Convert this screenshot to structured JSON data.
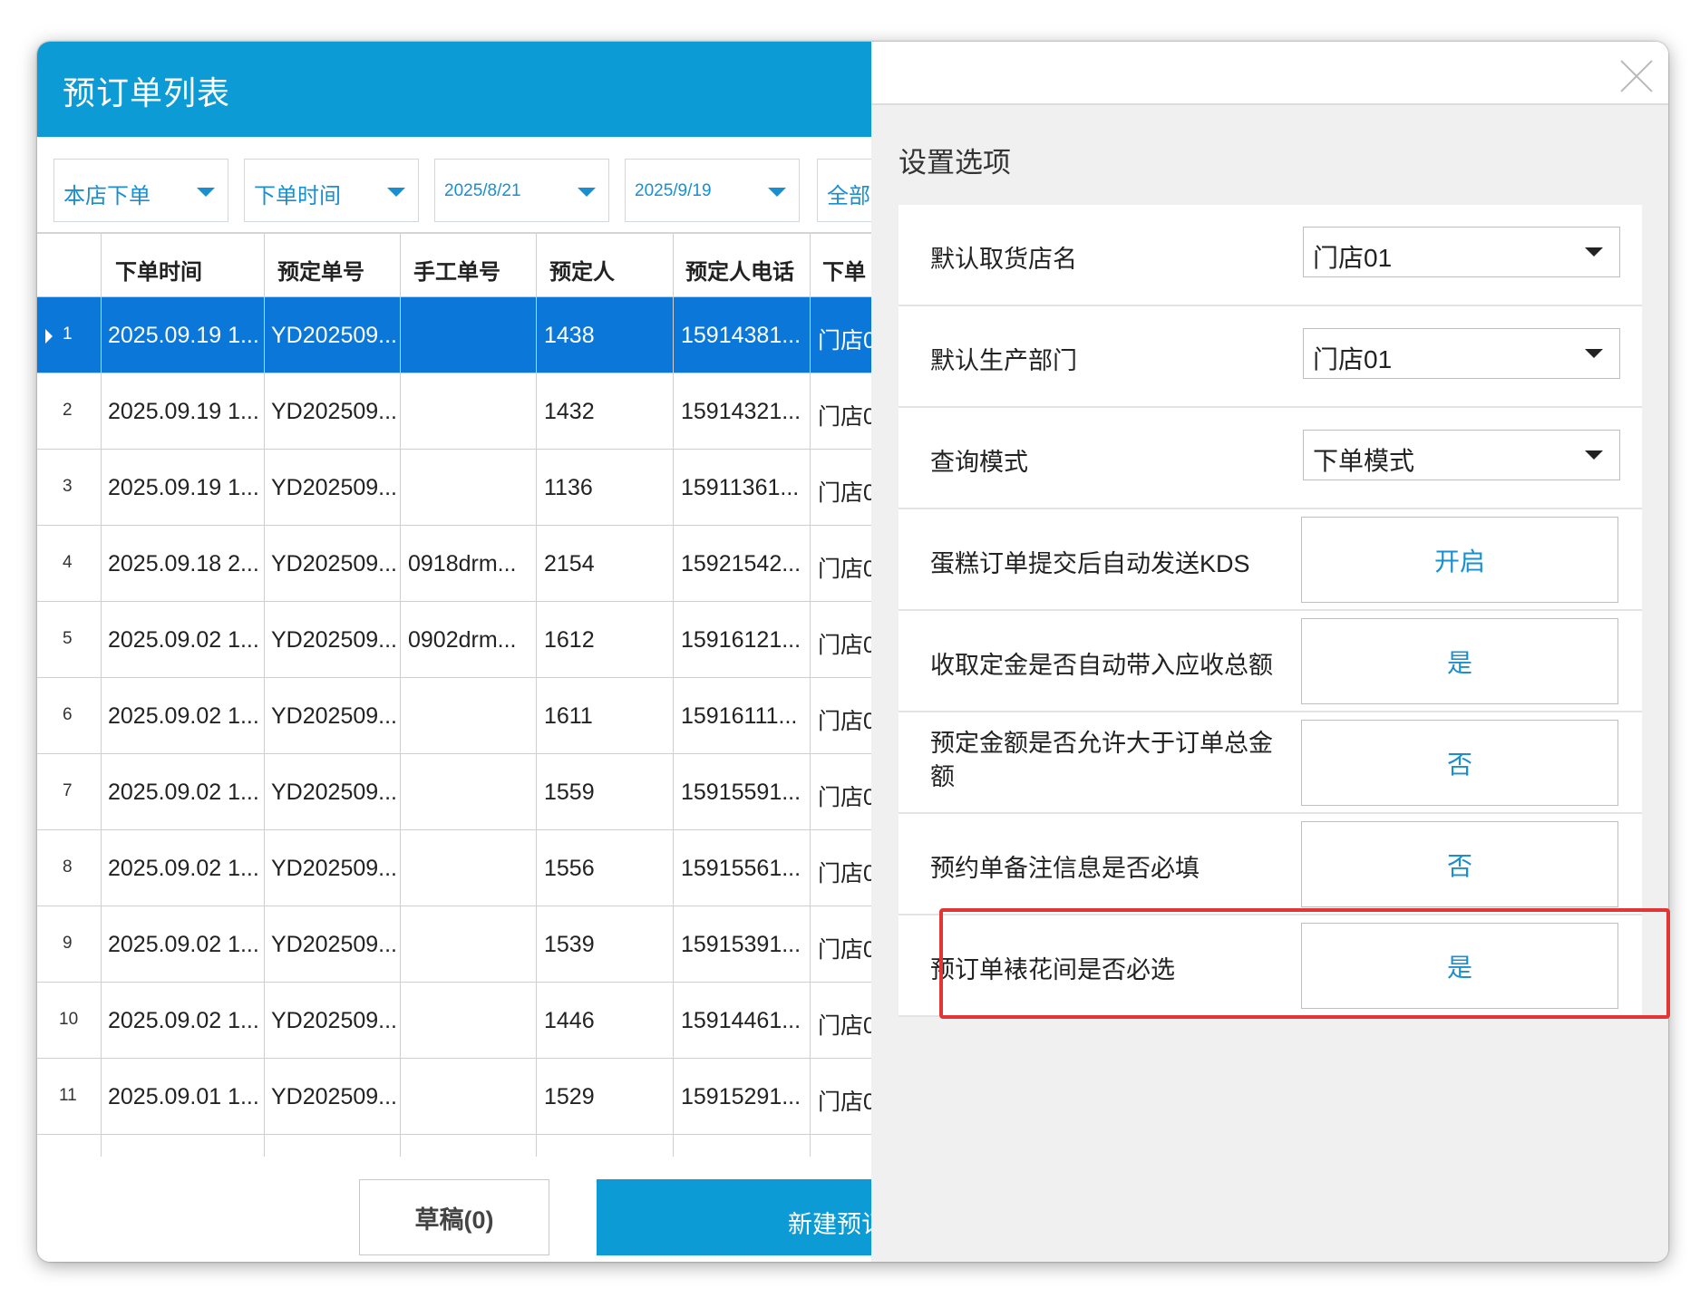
{
  "left_panel": {
    "title": "预订单列表",
    "filters": {
      "store": "本店下单",
      "time_type": "下单时间",
      "date_from": "2025/8/21",
      "date_to": "2025/9/19",
      "status": "全部"
    },
    "columns": [
      "下单时间",
      "预定单号",
      "手工单号",
      "预定人",
      "预定人电话",
      "下单"
    ],
    "rows": [
      {
        "no": "1",
        "time": "2025.09.19 1...",
        "order": "YD202509...",
        "manual": "",
        "person": "1438",
        "phone": "15914381...",
        "store": "门店0"
      },
      {
        "no": "2",
        "time": "2025.09.19 1...",
        "order": "YD202509...",
        "manual": "",
        "person": "1432",
        "phone": "15914321...",
        "store": "门店0"
      },
      {
        "no": "3",
        "time": "2025.09.19 1...",
        "order": "YD202509...",
        "manual": "",
        "person": "1136",
        "phone": "15911361...",
        "store": "门店0"
      },
      {
        "no": "4",
        "time": "2025.09.18 2...",
        "order": "YD202509...",
        "manual": "0918drm...",
        "person": "2154",
        "phone": "15921542...",
        "store": "门店0"
      },
      {
        "no": "5",
        "time": "2025.09.02 1...",
        "order": "YD202509...",
        "manual": "0902drm...",
        "person": "1612",
        "phone": "15916121...",
        "store": "门店0"
      },
      {
        "no": "6",
        "time": "2025.09.02 1...",
        "order": "YD202509...",
        "manual": "",
        "person": "1611",
        "phone": "15916111...",
        "store": "门店0"
      },
      {
        "no": "7",
        "time": "2025.09.02 1...",
        "order": "YD202509...",
        "manual": "",
        "person": "1559",
        "phone": "15915591...",
        "store": "门店0"
      },
      {
        "no": "8",
        "time": "2025.09.02 1...",
        "order": "YD202509...",
        "manual": "",
        "person": "1556",
        "phone": "15915561...",
        "store": "门店0"
      },
      {
        "no": "9",
        "time": "2025.09.02 1...",
        "order": "YD202509...",
        "manual": "",
        "person": "1539",
        "phone": "15915391...",
        "store": "门店0"
      },
      {
        "no": "10",
        "time": "2025.09.02 1...",
        "order": "YD202509...",
        "manual": "",
        "person": "1446",
        "phone": "15914461...",
        "store": "门店0"
      },
      {
        "no": "11",
        "time": "2025.09.01 1...",
        "order": "YD202509...",
        "manual": "",
        "person": "1529",
        "phone": "15915291...",
        "store": "门店0"
      }
    ],
    "draft_button": "草稿(0)",
    "new_button": "新建预订"
  },
  "right_panel": {
    "title": "设置选项",
    "settings": [
      {
        "label": "默认取货店名",
        "type": "select",
        "value": "门店01"
      },
      {
        "label": "默认生产部门",
        "type": "select",
        "value": "门店01"
      },
      {
        "label": "查询模式",
        "type": "select",
        "value": "下单模式"
      },
      {
        "label": "蛋糕订单提交后自动发送KDS",
        "type": "toggle",
        "value": "开启"
      },
      {
        "label": "收取定金是否自动带入应收总额",
        "type": "toggle",
        "value": "是"
      },
      {
        "label": "预定金额是否允许大于订单总金额",
        "type": "toggle",
        "value": "否"
      },
      {
        "label": "预约单备注信息是否必填",
        "type": "toggle",
        "value": "否"
      },
      {
        "label": "预订单裱花间是否必选",
        "type": "toggle",
        "value": "是"
      }
    ]
  },
  "colors": {
    "accent": "#0d9bd5",
    "selected_row": "#0b78d9",
    "link_text": "#1a8fd0",
    "highlight_border": "#e23535"
  }
}
